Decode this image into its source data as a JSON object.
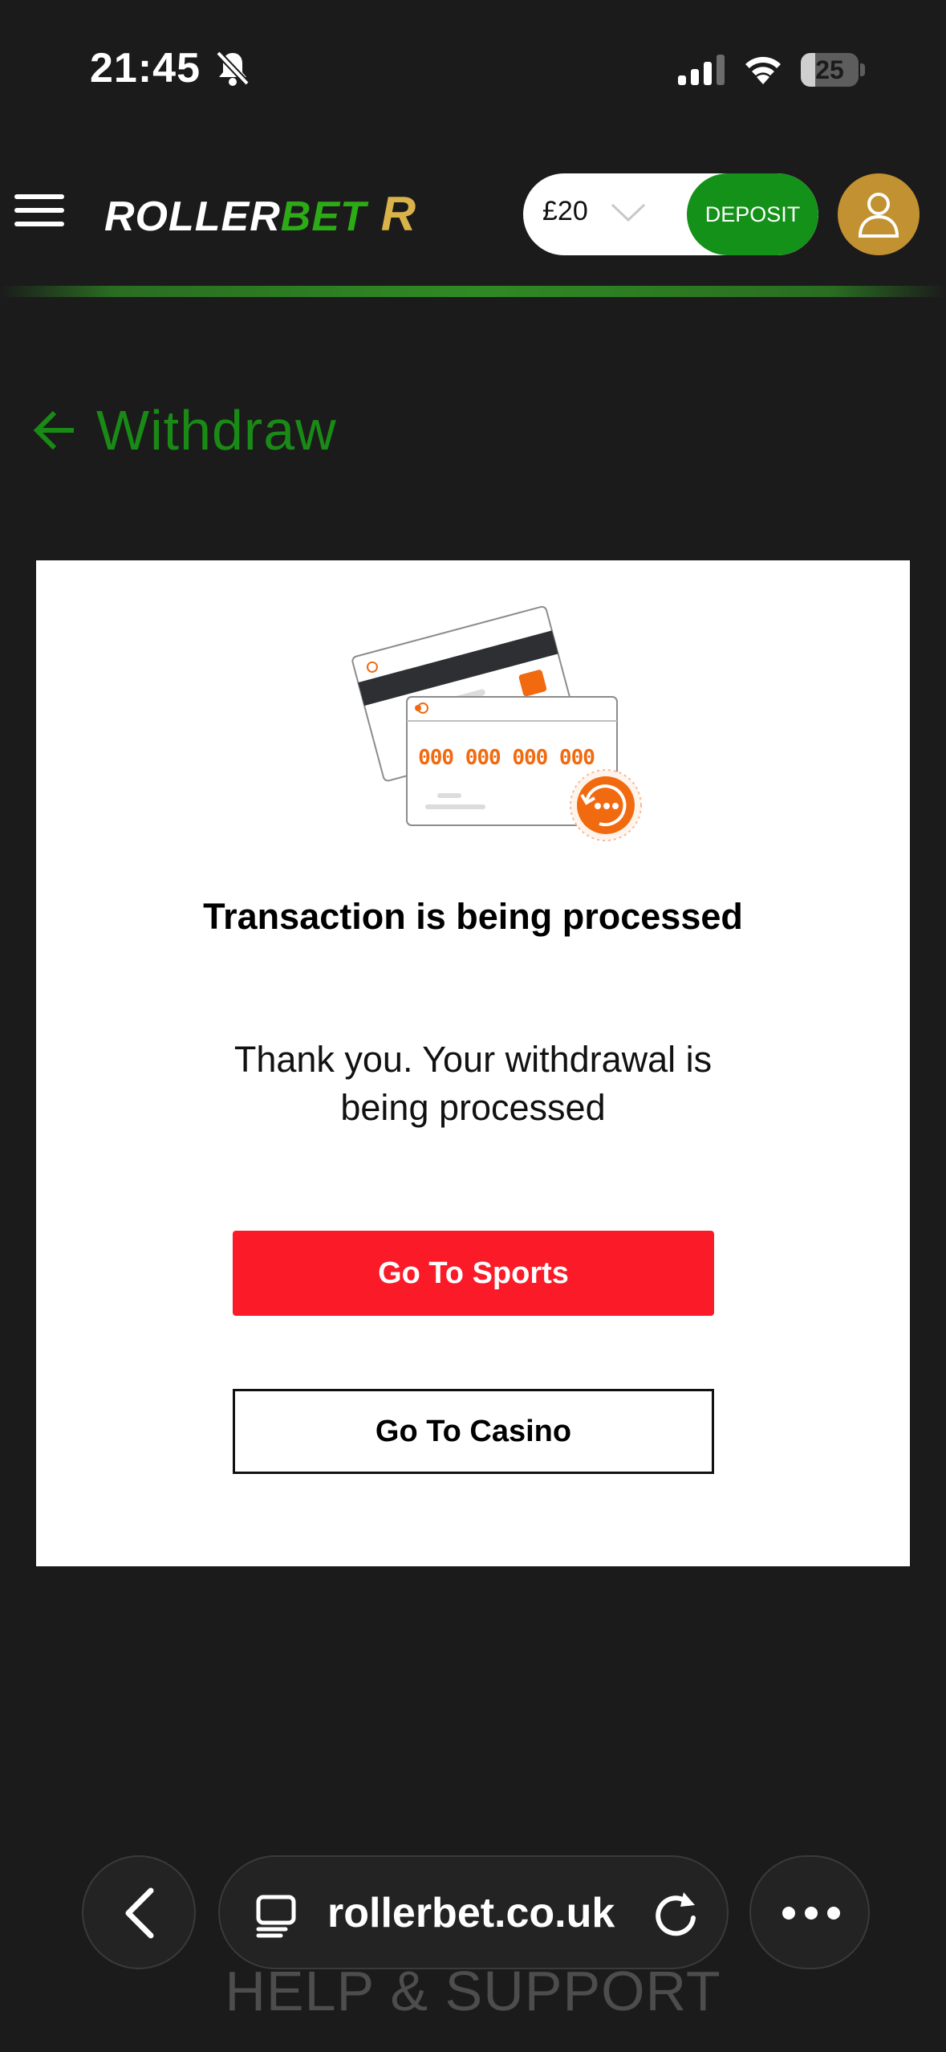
{
  "status_bar": {
    "time": "21:45",
    "battery": "25",
    "battery_fraction": 0.25
  },
  "header": {
    "logo": {
      "part1": "ROLLER",
      "part2": "BET",
      "mark": "R"
    },
    "balance": "£20",
    "deposit_label": "DEPOSIT"
  },
  "page": {
    "title": "Withdraw"
  },
  "card": {
    "illustration_digits": "000 000 000 000",
    "heading": "Transaction is being processed",
    "message": "Thank you. Your withdrawal is being processed",
    "sports_label": "Go To Sports",
    "casino_label": "Go To Casino"
  },
  "browser": {
    "url": "rollerbet.co.uk"
  },
  "footer": {
    "help": "HELP & SUPPORT"
  },
  "colors": {
    "background": "#1b1b1b",
    "brand_green": "#1a8a16",
    "deposit_green": "#149118",
    "avatar_gold": "#c29132",
    "sports_red": "#fb1a27",
    "illustration_orange": "#f26a10"
  },
  "icons": [
    "bell-slash-icon",
    "signal-icon",
    "wifi-icon",
    "menu-icon",
    "chevron-down-icon",
    "user-icon",
    "back-arrow-icon",
    "card-icon",
    "tabs-icon",
    "reload-icon",
    "more-icon"
  ]
}
